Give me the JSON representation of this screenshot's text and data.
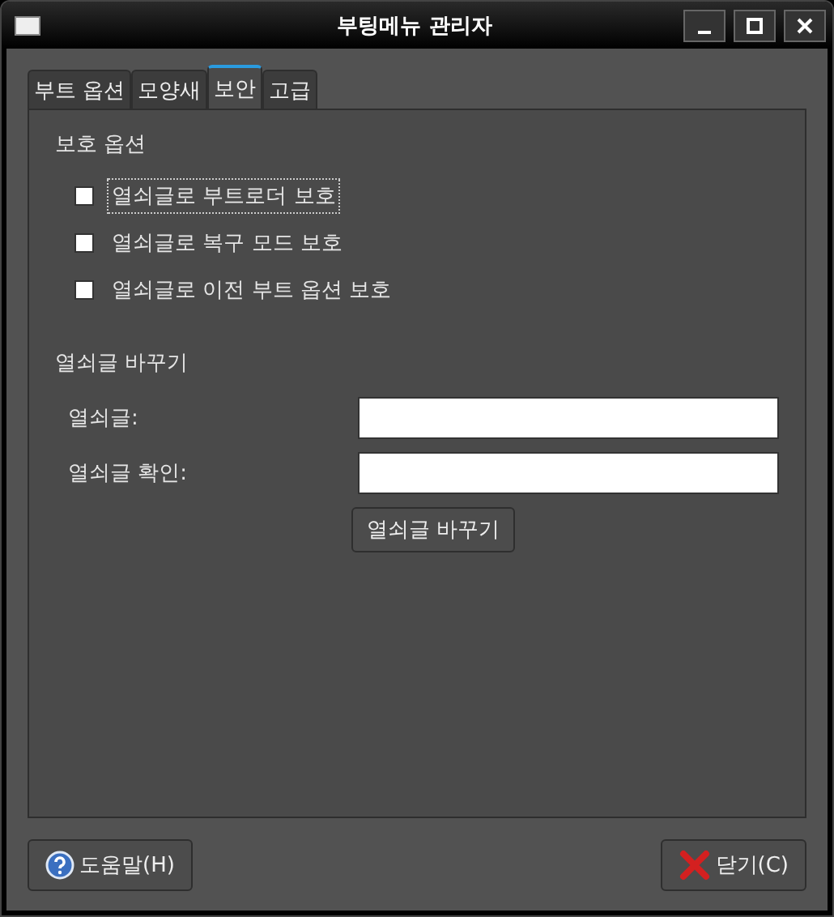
{
  "window": {
    "title": "부팅메뉴 관리자"
  },
  "tabs": [
    {
      "label": "부트 옵션",
      "selected": false
    },
    {
      "label": "모양새",
      "selected": false
    },
    {
      "label": "보안",
      "selected": true
    },
    {
      "label": "고급",
      "selected": false
    }
  ],
  "protection": {
    "heading": "보호 옵션",
    "options": [
      {
        "label": "열쇠글로 부트로더 보호",
        "checked": false,
        "focused": true
      },
      {
        "label": "열쇠글로 복구 모드 보호",
        "checked": false,
        "focused": false
      },
      {
        "label": "열쇠글로 이전 부트 옵션 보호",
        "checked": false,
        "focused": false
      }
    ]
  },
  "change_password": {
    "heading": "열쇠글 바꾸기",
    "fields": [
      {
        "label": "열쇠글:"
      },
      {
        "label": "열쇠글 확인:"
      }
    ],
    "button": "열쇠글 바꾸기"
  },
  "buttons": [
    {
      "kind": "help",
      "label": "도움말(H)"
    },
    {
      "kind": "close",
      "label": "닫기(C)"
    }
  ]
}
